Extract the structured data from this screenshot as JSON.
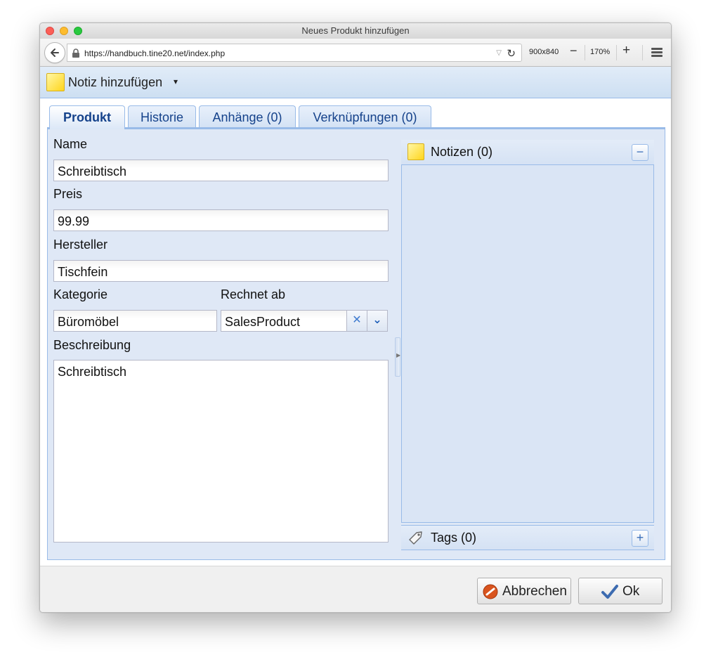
{
  "browser": {
    "window_title": "Neues Produkt hinzufügen",
    "url": "https://handbuch.tine20.net/index.php",
    "viewport_size": "900x840",
    "zoom_minus": "−",
    "zoom_level": "170%",
    "zoom_plus": "+"
  },
  "toolbar": {
    "add_note_label": "Notiz hinzufügen",
    "caret": "▾"
  },
  "tabs": [
    {
      "label": "Produkt",
      "active": true
    },
    {
      "label": "Historie",
      "active": false
    },
    {
      "label": "Anhänge (0)",
      "active": false
    },
    {
      "label": "Verknüpfungen (0)",
      "active": false
    }
  ],
  "form": {
    "name": {
      "label": "Name",
      "value": "Schreibtisch"
    },
    "price": {
      "label": "Preis",
      "value": "99.99"
    },
    "manufacturer": {
      "label": "Hersteller",
      "value": "Tischfein"
    },
    "category": {
      "label": "Kategorie",
      "value": "Büromöbel"
    },
    "accountable": {
      "label": "Rechnet ab",
      "value": "SalesProduct",
      "clear_glyph": "✕",
      "trigger_glyph": "⌄"
    },
    "description": {
      "label": "Beschreibung",
      "value": "Schreibtisch"
    }
  },
  "sidebar": {
    "notes": {
      "label": "Notizen (0)",
      "toggle_glyph": "−"
    },
    "tags": {
      "label": "Tags (0)",
      "add_glyph": "+"
    }
  },
  "footer": {
    "cancel_label": "Abbrechen",
    "ok_label": "Ok"
  },
  "colors": {
    "accent": "#15428b",
    "panel_bg": "#dfe8f6",
    "border": "#99bbe8"
  }
}
